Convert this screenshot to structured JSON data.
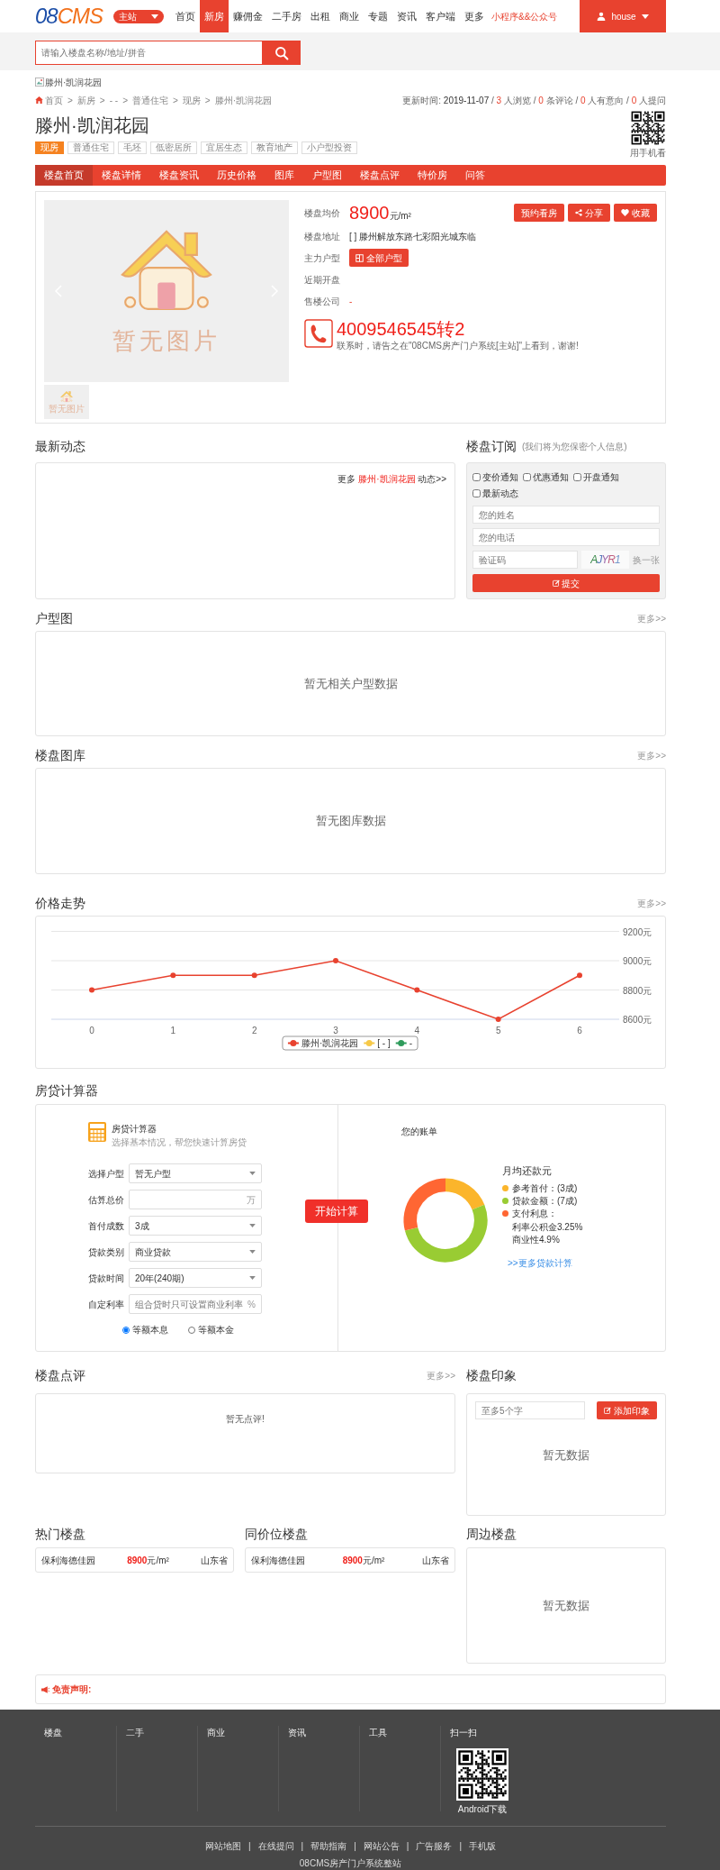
{
  "header": {
    "logo": "08CMS",
    "site_select": "主站",
    "nav": [
      {
        "label": "首页",
        "selected": false
      },
      {
        "label": "新房",
        "selected": true
      },
      {
        "label": "赚佣金",
        "selected": false
      },
      {
        "label": "二手房",
        "selected": false
      },
      {
        "label": "出租",
        "selected": false
      },
      {
        "label": "商业",
        "selected": false
      },
      {
        "label": "专题",
        "selected": false
      },
      {
        "label": "资讯",
        "selected": false
      },
      {
        "label": "客户端",
        "selected": false
      },
      {
        "label": "更多",
        "selected": false
      }
    ],
    "promo": "小程序&&公众号",
    "user": "house"
  },
  "search": {
    "placeholder": "请输入楼盘名称/地址/拼音"
  },
  "banner_alt": "滕州·凯润花园",
  "breadcrumb": {
    "items": [
      "首页",
      "新房",
      "- -",
      "普通住宅",
      "现房",
      "滕州·凯润花园"
    ],
    "separator": ">"
  },
  "stats": {
    "update_label": "更新时间:",
    "date": "2019-11-07",
    "separator": "/",
    "items": [
      {
        "count": "3",
        "label": "人浏览"
      },
      {
        "count": "0",
        "label": "条评论"
      },
      {
        "count": "0",
        "label": "人有意向"
      },
      {
        "count": "0",
        "label": "人提问"
      }
    ]
  },
  "title": "滕州·凯润花园",
  "tags": [
    {
      "label": "现房",
      "highlighted": true
    },
    {
      "label": "普通住宅",
      "highlighted": false
    },
    {
      "label": "毛坯",
      "highlighted": false
    },
    {
      "label": "低密居所",
      "highlighted": false
    },
    {
      "label": "宜居生态",
      "highlighted": false
    },
    {
      "label": "教育地产",
      "highlighted": false
    },
    {
      "label": "小户型投资",
      "highlighted": false
    }
  ],
  "qr_caption": "用手机看",
  "tabs": [
    {
      "label": "楼盘首页",
      "selected": true
    },
    {
      "label": "楼盘详情",
      "selected": false
    },
    {
      "label": "楼盘资讯",
      "selected": false
    },
    {
      "label": "历史价格",
      "selected": false
    },
    {
      "label": "图库",
      "selected": false
    },
    {
      "label": "户型图",
      "selected": false
    },
    {
      "label": "楼盘点评",
      "selected": false
    },
    {
      "label": "特价房",
      "selected": false
    },
    {
      "label": "问答",
      "selected": false
    }
  ],
  "overview": {
    "photo_text": "暂无图片",
    "thumb_text": "暂无图片",
    "fields": [
      {
        "label": "楼盘均价",
        "kind": "price",
        "value": "8900",
        "unit": "元/m²"
      },
      {
        "label": "楼盘地址",
        "kind": "text",
        "value": "[ ] 滕州解放东路七彩阳光城东临"
      },
      {
        "label": "主力户型",
        "kind": "button",
        "value": "全部户型"
      },
      {
        "label": "近期开盘",
        "kind": "text"
      },
      {
        "label": "售楼公司",
        "kind": "accent",
        "value": "-"
      }
    ],
    "actions": [
      {
        "label": "预约看房",
        "kind": "plain"
      },
      {
        "label": "分享",
        "kind": "share"
      },
      {
        "label": "收藏",
        "kind": "favorite"
      }
    ],
    "phone": "4009546545转2",
    "phone_note": "联系时，请告之在\"08CMS房产门户系统[主站]\"上看到，谢谢!"
  },
  "news": {
    "title": "最新动态",
    "more_prefix": "更多",
    "more_link": "滕州·凯润花园",
    "more_suffix": "动态>>"
  },
  "subscribe": {
    "title": "楼盘订阅",
    "note": "(我们将为您保密个人信息)",
    "options": [
      {
        "label": "变价通知",
        "checked": false
      },
      {
        "label": "优惠通知",
        "checked": false
      },
      {
        "label": "开盘通知",
        "checked": false
      },
      {
        "label": "最新动态",
        "checked": false
      }
    ],
    "name_placeholder": "您的姓名",
    "phone_placeholder": "您的电话",
    "captcha_placeholder": "验证码",
    "captcha": "AJYR1",
    "captcha_refresh": "换一张",
    "submit": "提交"
  },
  "floorplans": {
    "title": "户型图",
    "more": "更多>>",
    "empty": "暂无相关户型数据"
  },
  "gallery": {
    "title": "楼盘图库",
    "more": "更多>>",
    "empty": "暂无图库数据"
  },
  "price_trend": {
    "title": "价格走势",
    "more": "更多>>",
    "chart_data": {
      "type": "line",
      "categories": [
        "0",
        "1",
        "2",
        "3",
        "4",
        "5",
        "6"
      ],
      "series": [
        {
          "name": "滕州·凯润花园",
          "color": "#e8422f",
          "marker": true,
          "values": [
            8800,
            8900,
            8900,
            9000,
            8800,
            8600,
            8900
          ]
        },
        {
          "name": "[ - ]",
          "color": "#f7c948",
          "values": [
            null,
            null,
            null,
            null,
            null,
            null,
            null
          ]
        },
        {
          "name": "-",
          "color": "#2e9b5b",
          "values": [
            null,
            null,
            null,
            null,
            null,
            null,
            null
          ]
        }
      ],
      "ylim": [
        8600,
        9200
      ],
      "yticks": [
        {
          "value": 8600,
          "label": "8600元"
        },
        {
          "value": 8800,
          "label": "8800元"
        },
        {
          "value": 9000,
          "label": "9000元"
        },
        {
          "value": 9200,
          "label": "9200元"
        }
      ]
    }
  },
  "calculator": {
    "title": "房贷计算器",
    "panel_title": "房贷计算器",
    "panel_subtitle": "选择基本情况，帮您快速计算房贷",
    "fields": [
      {
        "label": "选择户型",
        "kind": "select",
        "value": "暂无户型"
      },
      {
        "label": "估算总价",
        "kind": "input",
        "suffix": "万"
      },
      {
        "label": "首付成数",
        "kind": "select",
        "value": "3成"
      },
      {
        "label": "贷款类别",
        "kind": "select",
        "value": "商业贷款"
      },
      {
        "label": "贷款时间",
        "kind": "select",
        "value": "20年(240期)"
      },
      {
        "label": "自定利率",
        "kind": "input",
        "placeholder": "组合贷时只可设置商业利率",
        "suffix": "%"
      }
    ],
    "methods": [
      {
        "label": "等额本息",
        "selected": true
      },
      {
        "label": "等额本金",
        "selected": false
      }
    ],
    "button": "开始计算",
    "bill_title": "您的账单",
    "monthly": "月均还款元",
    "legend": [
      {
        "label": "参考首付：(3成)",
        "color": "#fbb52b"
      },
      {
        "label": "贷款金额：(7成)",
        "color": "#99cc33"
      },
      {
        "label": "支付利息：",
        "color": "#ff6633"
      }
    ],
    "rates": [
      "利率公积金3.25%",
      "商业性4.9%"
    ],
    "more_link": ">>更多贷款计算"
  },
  "reviews": {
    "title": "楼盘点评",
    "more": "更多>>",
    "empty": "暂无点评!"
  },
  "impression": {
    "title": "楼盘印象",
    "placeholder": "至多5个字",
    "button": "添加印象",
    "empty": "暂无数据"
  },
  "hot": {
    "title": "热门楼盘",
    "rows": [
      {
        "name": "保利海德佳园",
        "price": "8900",
        "unit": "元/m²",
        "region": "山东省"
      }
    ]
  },
  "same_price": {
    "title": "同价位楼盘",
    "rows": [
      {
        "name": "保利海德佳园",
        "price": "8900",
        "unit": "元/m²",
        "region": "山东省"
      }
    ]
  },
  "nearby": {
    "title": "周边楼盘",
    "empty": "暂无数据"
  },
  "disclaimer": "免责声明:",
  "footer": {
    "columns": [
      "楼盘",
      "二手",
      "商业",
      "资讯",
      "工具",
      "扫一扫"
    ],
    "qr_caption": "Android下载",
    "links": [
      "网站地图",
      "在线提问",
      "帮助指南",
      "网站公告",
      "广告服务",
      "手机版"
    ],
    "separator": "|",
    "copyright": "08CMS房产门户系统整站"
  }
}
